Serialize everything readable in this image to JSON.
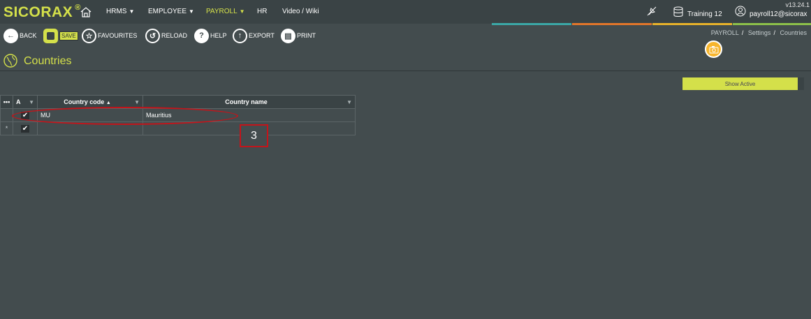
{
  "header": {
    "logo": "SICORAX",
    "logo_mark": "®",
    "version": "v13.24.1",
    "nav": [
      {
        "label": "HRMS",
        "caret": true
      },
      {
        "label": "EMPLOYEE",
        "caret": true
      },
      {
        "label": "PAYROLL",
        "caret": true,
        "active": true
      },
      {
        "label": "HR",
        "caret": false
      },
      {
        "label": "Video / Wiki",
        "caret": false
      }
    ],
    "database": "Training 12",
    "user": "payroll12@sicorax"
  },
  "stripes": [
    "#3ba8a6",
    "#e2762a",
    "#e8b22a",
    "#8cc04a"
  ],
  "toolbar": {
    "back": "BACK",
    "save": "SAVE",
    "favourites": "FAVOURITES",
    "reload": "RELOAD",
    "help": "HELP",
    "export": "EXPORT",
    "print": "PRINT"
  },
  "breadcrumb": [
    "PAYROLL",
    "Settings",
    "Countries"
  ],
  "page": {
    "title": "Countries"
  },
  "show_active": "Show Active",
  "grid": {
    "headers": {
      "menu": "•••",
      "active": "A",
      "code": "Country code",
      "name": "Country name"
    },
    "rows": [
      {
        "code": "MU",
        "name": "Mauritius",
        "active": true
      }
    ],
    "new_row_marker": "*"
  },
  "annotation": {
    "label": "3"
  },
  "colors": {
    "accent": "#d4e04a",
    "background": "#434c4e",
    "topbar": "#3a4345",
    "annotation": "#c4141a",
    "camera": "#f7b52c"
  }
}
